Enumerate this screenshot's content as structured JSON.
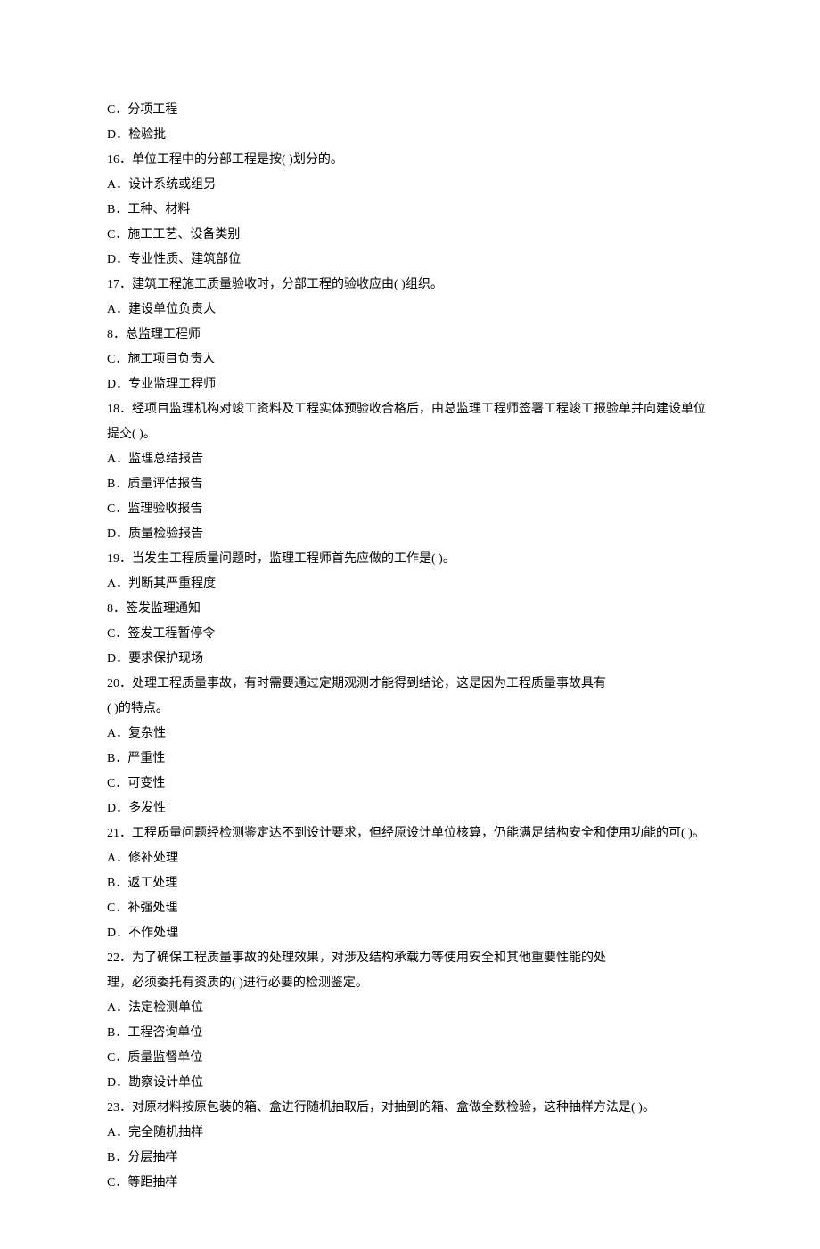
{
  "lines": [
    "C．分项工程",
    "D．检验批",
    "16．单位工程中的分部工程是按( )划分的。",
    "A．设计系统或组另",
    "B．工种、材料",
    "C．施工工艺、设备类别",
    "D．专业性质、建筑部位",
    "17．建筑工程施工质量验收时，分部工程的验收应由( )组织。",
    "A．建设单位负责人",
    "8．总监理工程师",
    "C．施工项目负责人",
    "D．专业监理工程师",
    "18．经项目监理机构对竣工资料及工程实体预验收合格后，由总监理工程师签署工程竣工报验单并向建设单位提交( )。",
    "A．监理总结报告",
    "B．质量评估报告",
    "C．监理验收报告",
    "D．质量检验报告",
    "19．当发生工程质量问题时，监理工程师首先应做的工作是( )。",
    "A．判断其严重程度",
    "8．签发监理通知",
    "C．签发工程暂停令",
    "D．要求保护现场",
    "20．处理工程质量事故，有时需要通过定期观测才能得到结论，这是因为工程质量事故具有",
    "( )的特点。",
    "A．复杂性",
    "B．严重性",
    "C．可变性",
    "D．多发性",
    "21．工程质量问题经检测鉴定达不到设计要求，但经原设计单位核算，仍能满足结构安全和使用功能的可( )。",
    "A．修补处理",
    "B．返工处理",
    "C．补强处理",
    "D．不作处理",
    "22．为了确保工程质量事故的处理效果，对涉及结构承载力等使用安全和其他重要性能的处",
    "理，必须委托有资质的( )进行必要的检测鉴定。",
    "A．法定检测单位",
    "B．工程咨询单位",
    "C．质量监督单位",
    "D．勘察设计单位",
    "23．对原材料按原包装的箱、盒进行随机抽取后，对抽到的箱、盒做全数检验，这种抽样方法是( )。",
    "A．完全随机抽样",
    "B．分层抽样",
    "C．等距抽样"
  ]
}
